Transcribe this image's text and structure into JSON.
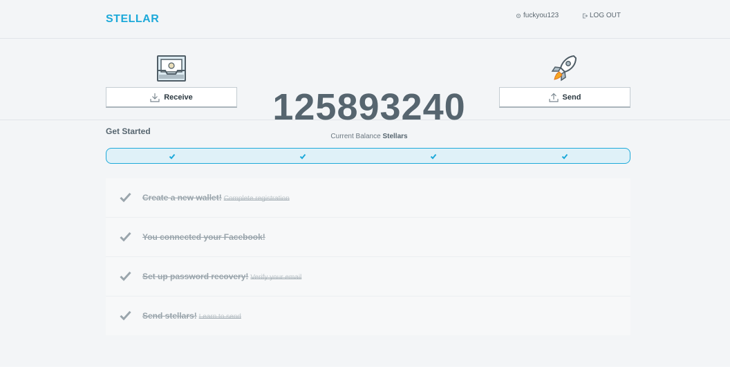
{
  "header": {
    "logo": "STELLAR",
    "username": "fuckyou123",
    "logout_label": "LOG OUT"
  },
  "balance": {
    "amount": "125893240",
    "label_prefix": "Current Balance",
    "label_unit": "Stellars",
    "receive_label": "Receive",
    "send_label": "Send"
  },
  "get_started": {
    "title": "Get Started",
    "progress_steps_completed": 4,
    "progress_steps_total": 4,
    "tasks": [
      {
        "title": "Create a new wallet!",
        "subtitle": "Complete registration"
      },
      {
        "title": "You connected your Facebook!",
        "subtitle": ""
      },
      {
        "title": "Set up password recovery!",
        "subtitle": "Verify your email"
      },
      {
        "title": "Send stellars!",
        "subtitle": "Learn to send"
      }
    ]
  },
  "colors": {
    "accent": "#1ca9d9",
    "text": "#56656f",
    "rocket_flame": "#f5a623"
  },
  "icons": {
    "receive": "inbox-tray-icon",
    "send": "rocket-icon",
    "task": "checkmark-icon"
  }
}
